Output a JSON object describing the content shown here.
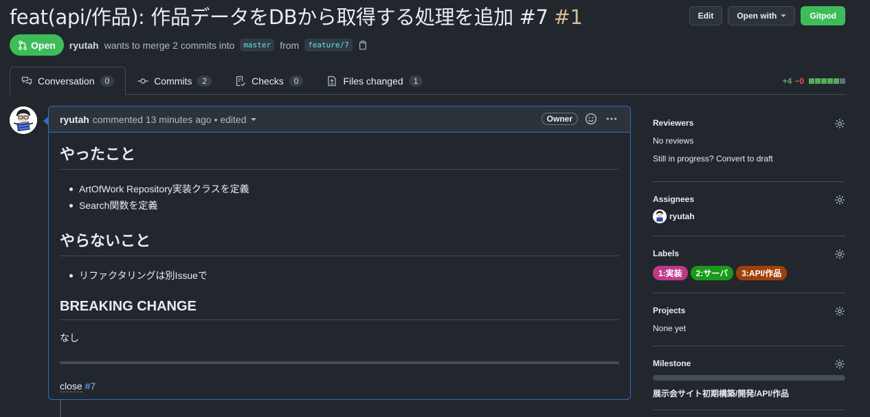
{
  "header": {
    "title": "feat(api/作品): 作品データをDBから取得する処理を追加 #7",
    "number": "#1",
    "edit_label": "Edit",
    "open_with_label": "Open with",
    "gitpod_label": "Gitpod"
  },
  "state": {
    "badge": "Open",
    "author": "ryutah",
    "wants_text": "wants to merge 2 commits into",
    "base_branch": "master",
    "from_text": "from",
    "head_branch": "feature/7"
  },
  "tabs": [
    {
      "label": "Conversation",
      "count": "0"
    },
    {
      "label": "Commits",
      "count": "2"
    },
    {
      "label": "Checks",
      "count": "0"
    },
    {
      "label": "Files changed",
      "count": "1"
    }
  ],
  "diffstat": {
    "additions": "+4",
    "deletions": "−0"
  },
  "comment": {
    "author": "ryutah",
    "meta": "commented 13 minutes ago",
    "edited": "• edited",
    "owner_badge": "Owner",
    "h1": "やったこと",
    "list1": [
      "ArtOfWork Repository実装クラスを定義",
      "Search関数を定義"
    ],
    "h2": "やらないこと",
    "list2": [
      "リファクタリングは別Issueで"
    ],
    "h3": "BREAKING CHANGE",
    "p": "なし",
    "close_kw": "close",
    "close_ref": "#7"
  },
  "sidebar": {
    "reviewers": {
      "title": "Reviewers",
      "value": "No reviews",
      "draft": "Still in progress? Convert to draft"
    },
    "assignees": {
      "title": "Assignees",
      "value": "ryutah"
    },
    "labels": {
      "title": "Labels",
      "items": [
        {
          "name": "1:実装",
          "color": "#bf3989"
        },
        {
          "name": "2:サーバ",
          "color": "#1a9a1a"
        },
        {
          "name": "3:API/作品",
          "color": "#a0400a"
        }
      ]
    },
    "projects": {
      "title": "Projects",
      "value": "None yet"
    },
    "milestone": {
      "title": "Milestone",
      "value": "展示会サイト初期構築/開発/API/作品",
      "progress": 0
    }
  },
  "colors": {
    "accent": "#316dca",
    "open_green": "#3ebc5a",
    "link": "#6cb6ff"
  }
}
